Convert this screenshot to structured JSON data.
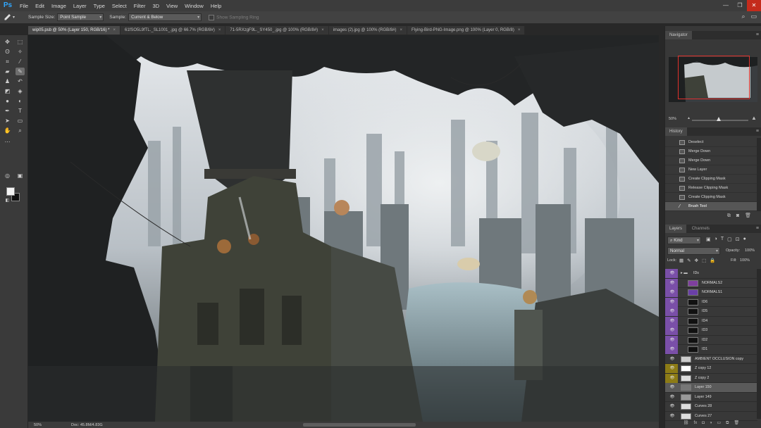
{
  "app": {
    "logo": "Ps"
  },
  "menubar": {
    "items": [
      "File",
      "Edit",
      "Image",
      "Layer",
      "Type",
      "Select",
      "Filter",
      "3D",
      "View",
      "Window",
      "Help"
    ]
  },
  "window_controls": {
    "minimize": "—",
    "restore": "❐",
    "close": "✕"
  },
  "options_bar": {
    "sample_size_label": "Sample Size:",
    "sample_size_value": "Point Sample",
    "sample_label": "Sample:",
    "sample_value": "Current & Below",
    "show_ring_label": "Show Sampling Ring"
  },
  "tabs": [
    {
      "label": "wip05.psb @ 50% (Layer 150, RGB/16) *",
      "active": true
    },
    {
      "label": "61fSO5L9fTL._SL1001_.jpg @ 66.7% (RGB/8#)",
      "active": false
    },
    {
      "label": "71-5RXzgF9L._SY450_.jpg @ 100% (RGB/8#)",
      "active": false
    },
    {
      "label": "images (2).jpg @ 100% (RGB/8#)",
      "active": false
    },
    {
      "label": "Flying-Bird-PNG-Image.png @ 100% (Layer 0, RGB/8)",
      "active": false
    }
  ],
  "status": {
    "zoom": "50%",
    "doc": "Doc: 45.8M/4.83G"
  },
  "navigator": {
    "title": "Navigator",
    "zoom": "50%"
  },
  "history": {
    "title": "History",
    "items": [
      "Deselect",
      "Merge Down",
      "Merge Down",
      "New Layer",
      "Create Clipping Mask",
      "Release Clipping Mask",
      "Create Clipping Mask",
      "Brush Tool"
    ],
    "active_index": 7
  },
  "layers_panel": {
    "tab_layers": "Layers",
    "tab_channels": "Channels",
    "filter_kind": "Kind",
    "blend_mode": "Normal",
    "opacity_label": "Opacity:",
    "opacity_value": "100%",
    "lock_label": "Lock:",
    "fill_label": "Fill:",
    "fill_value": "100%",
    "layers": [
      {
        "name": "IDs",
        "group": true,
        "color": "#7a4fa8"
      },
      {
        "name": "NORMALS2",
        "color": "#7a4fa8"
      },
      {
        "name": "NORMALS1",
        "color": "#7a4fa8"
      },
      {
        "name": "ID6",
        "color": "#7a4fa8"
      },
      {
        "name": "ID5",
        "color": "#7a4fa8"
      },
      {
        "name": "ID4",
        "color": "#7a4fa8"
      },
      {
        "name": "ID3",
        "color": "#7a4fa8"
      },
      {
        "name": "ID2",
        "color": "#7a4fa8"
      },
      {
        "name": "ID1",
        "color": "#7a4fa8"
      },
      {
        "name": "AMBIENT OCCLUSION copy",
        "color": ""
      },
      {
        "name": "Z copy 12",
        "color": "#8c7b16"
      },
      {
        "name": "Z copy 2",
        "color": "#8c7b16"
      },
      {
        "name": "Layer 150",
        "color": "",
        "active": true
      },
      {
        "name": "Layer 149",
        "color": ""
      },
      {
        "name": "Curves 28",
        "color": ""
      },
      {
        "name": "Curves 27",
        "color": ""
      }
    ]
  },
  "icons": {
    "eye": "eye-icon",
    "folder": "folder-icon",
    "search": "search-icon",
    "workspace": "workspace-icon",
    "trash": "trash-icon"
  }
}
